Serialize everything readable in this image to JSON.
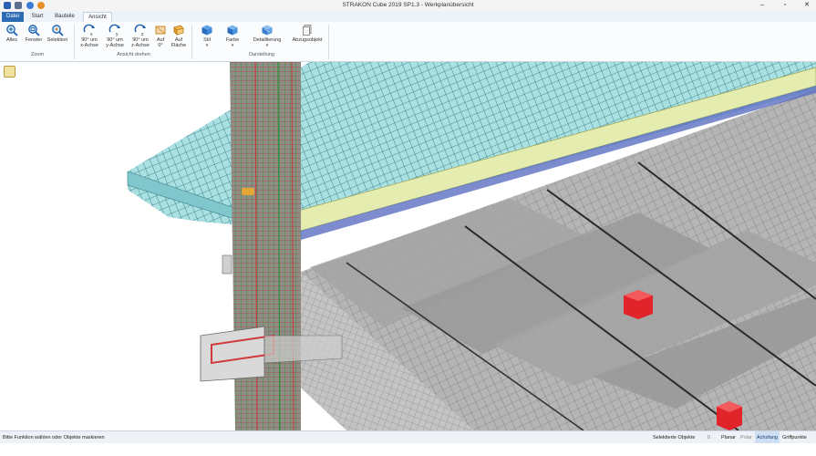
{
  "window": {
    "title": "STRAKON Cube 2019 SP1.3 - Werkplanübersicht"
  },
  "quick_access": [
    {
      "icon": "app-logo-icon",
      "color": "#2a62b0"
    },
    {
      "icon": "save-icon",
      "color": "#5b6e8c"
    },
    {
      "icon": "undo-icon",
      "color": "#3a7bd5"
    },
    {
      "icon": "redo-icon",
      "color": "#e5902a"
    }
  ],
  "window_controls": {
    "minimize": "–",
    "maximize": "▫",
    "close": "✕"
  },
  "tabs": [
    "Datei",
    "Start",
    "Bauteile",
    "Ansicht"
  ],
  "ribbon": {
    "zoom": {
      "group_label": "Zoom",
      "buttons": [
        "Alles",
        "Fenster",
        "Selektion"
      ]
    },
    "rotate": {
      "group_label": "Ansicht drehen",
      "buttons": [
        [
          "90° um",
          "x-Achse"
        ],
        [
          "90° um",
          "y-Achse"
        ],
        [
          "90° um",
          "z-Achse"
        ],
        [
          "Auf",
          "0°"
        ],
        [
          "Auf",
          "Fläche"
        ]
      ]
    },
    "display": {
      "group_label": "Darstellung",
      "buttons": [
        "Stil",
        "Farbe",
        "Detaillierung",
        "Abzugsobjekt"
      ]
    }
  },
  "status": {
    "message": "Bitte Funktion wählen oder Objekte markieren",
    "selected_label": "Selektierte Objekte",
    "selected_count": "0",
    "snap_modes": [
      "Planar",
      "Polar",
      "Achsfang",
      "Griffpunkte"
    ],
    "active_snap": "Achsfang"
  },
  "colors": {
    "accent": "#2b6cb5",
    "slab_mesh": "#9fdde0",
    "hollow_block": "#e0242a",
    "concrete": "#9a9a9a"
  }
}
